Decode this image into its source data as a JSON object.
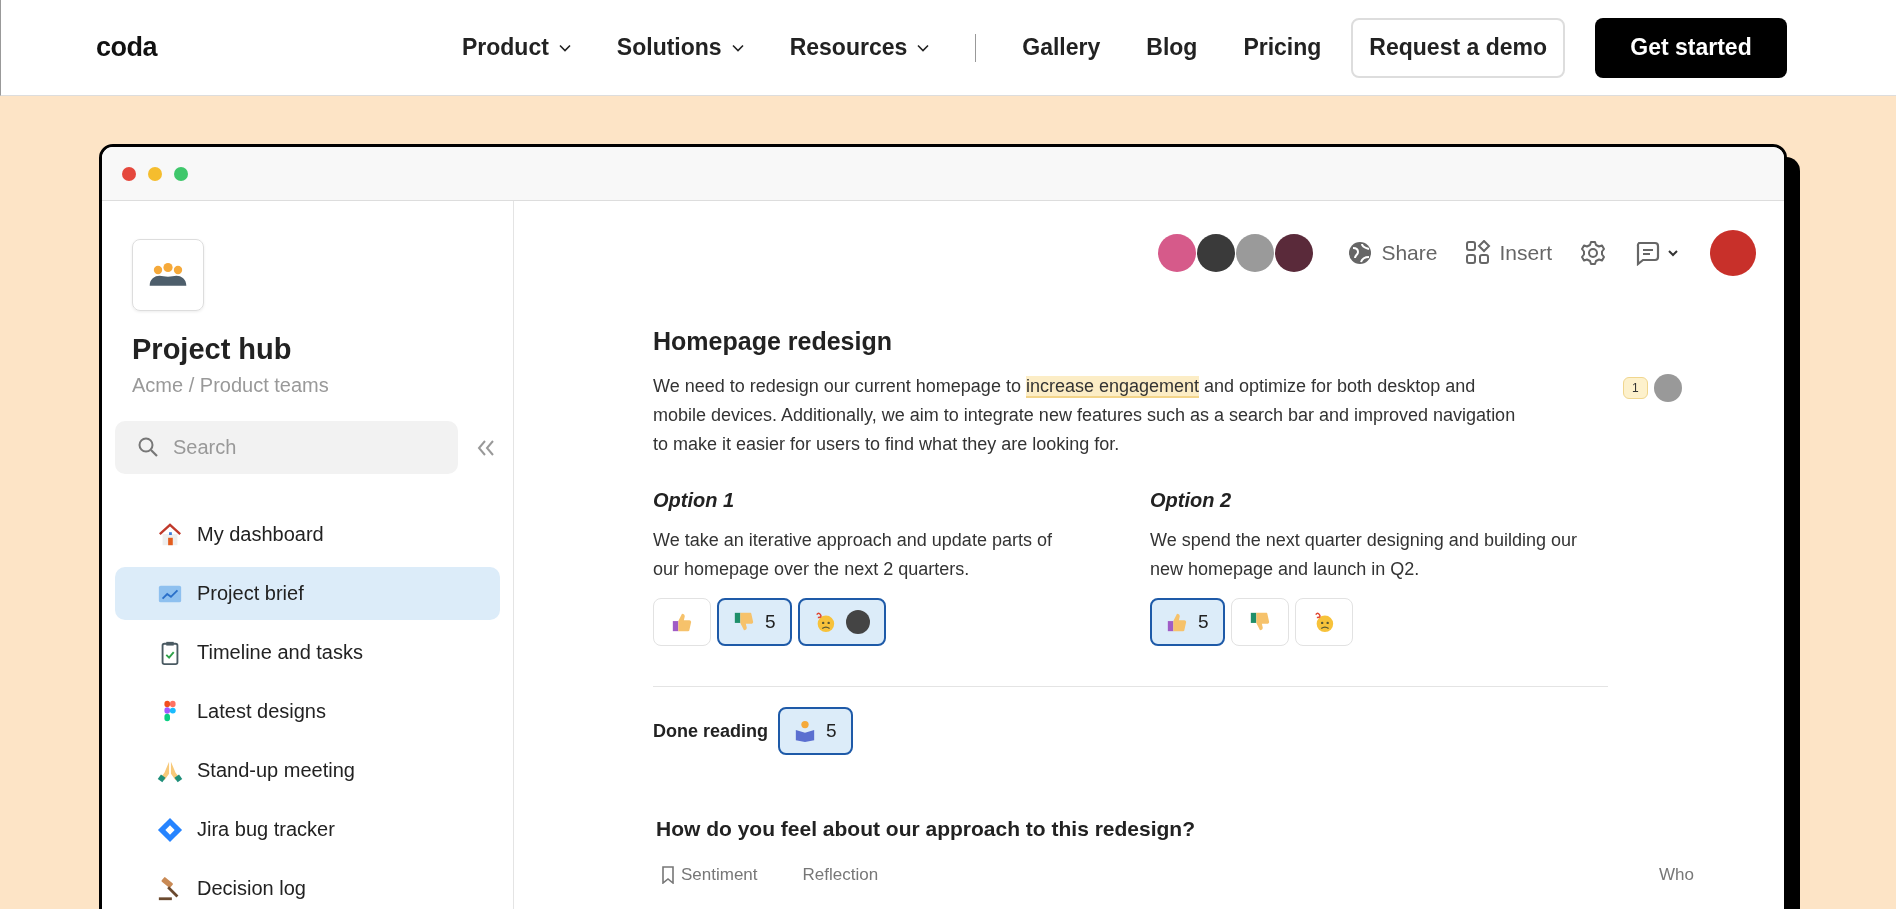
{
  "nav": {
    "logo": "coda",
    "menus": [
      {
        "label": "Product",
        "dropdown": true
      },
      {
        "label": "Solutions",
        "dropdown": true
      },
      {
        "label": "Resources",
        "dropdown": true
      }
    ],
    "links": [
      "Gallery",
      "Blog",
      "Pricing"
    ],
    "demo_button": "Request a demo",
    "start_button": "Get started"
  },
  "sidebar": {
    "title": "Project hub",
    "subtitle": "Acme / Product teams",
    "search": {
      "placeholder": "Search"
    },
    "items": [
      {
        "label": "My dashboard",
        "selected": false
      },
      {
        "label": "Project brief",
        "selected": true
      },
      {
        "label": "Timeline and tasks",
        "selected": false
      },
      {
        "label": "Latest designs",
        "selected": false
      },
      {
        "label": "Stand-up meeting",
        "selected": false
      },
      {
        "label": "Jira bug tracker",
        "selected": false
      },
      {
        "label": "Decision log",
        "selected": false
      }
    ]
  },
  "toolbar": {
    "share": "Share",
    "insert": "Insert"
  },
  "doc": {
    "title": "Homepage redesign",
    "paragraph": [
      {
        "text": "We need to redesign our current homepage to ",
        "highlighted": false
      },
      {
        "text": "increase engagement",
        "highlighted": true
      },
      {
        "text": " and optimize for both desktop and mobile devices. Additionally, we aim to integrate new features such as a search bar and improved navigation to make it easier for users to find what they are looking for.",
        "highlighted": false
      }
    ],
    "comment_count": "1",
    "options": [
      {
        "heading": "Option 1",
        "text": "We take an iterative approach and update parts of our homepage over the next 2 quarters.",
        "reactions": [
          {
            "kind": "thumbs-up",
            "selected": false
          },
          {
            "kind": "thumbs-down",
            "count": "5",
            "selected": true
          },
          {
            "kind": "confused",
            "selected": true,
            "avatar": true
          }
        ]
      },
      {
        "heading": "Option 2",
        "text": "We spend the next quarter designing and building our new homepage and launch in Q2.",
        "reactions": [
          {
            "kind": "thumbs-up",
            "count": "5",
            "selected": true
          },
          {
            "kind": "thumbs-down",
            "selected": false
          },
          {
            "kind": "confused",
            "selected": false
          }
        ]
      }
    ],
    "done_reading": {
      "label": "Done reading",
      "reaction": {
        "kind": "reading",
        "count": "5",
        "selected": true
      }
    },
    "question": "How do you feel about our approach to this redesign?",
    "columns": [
      "Sentiment",
      "Reflection",
      "Who"
    ]
  }
}
